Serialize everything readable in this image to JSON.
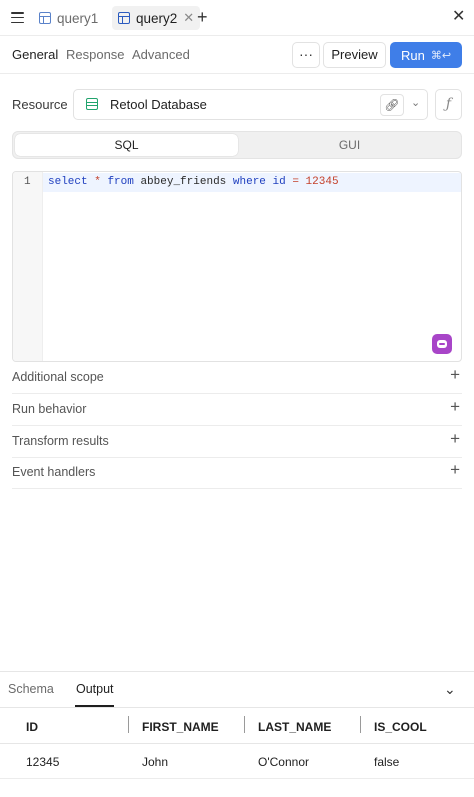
{
  "tabs": {
    "items": [
      {
        "label": "query1",
        "active": false
      },
      {
        "label": "query2",
        "active": true
      }
    ],
    "add_icon": "plus-icon",
    "close_icon": "close-icon"
  },
  "subnav": {
    "tabs": [
      "General",
      "Response",
      "Advanced"
    ],
    "active": "General",
    "more_label": "···",
    "preview_label": "Preview",
    "run_label": "Run",
    "run_shortcut": "⌘↩"
  },
  "resource": {
    "label": "Resource",
    "name": "Retool Database",
    "fx_label": "ƒ"
  },
  "mode": {
    "options": [
      "SQL",
      "GUI"
    ],
    "selected": "SQL"
  },
  "editor": {
    "line_number": "1",
    "tokens": {
      "t1": "select",
      "t2": "*",
      "t3": "from",
      "t4": "abbey_friends",
      "t5": "where",
      "t6": "id",
      "t7": "=",
      "t8": "12345"
    }
  },
  "sections": [
    "Additional scope",
    "Run behavior",
    "Transform results",
    "Event handlers"
  ],
  "bottom_panel": {
    "tabs": [
      "Schema",
      "Output"
    ],
    "active": "Output",
    "table": {
      "columns": [
        "ID",
        "FIRST_NAME",
        "LAST_NAME",
        "IS_COOL"
      ],
      "rows": [
        [
          "12345",
          "John",
          "O'Connor",
          "false"
        ]
      ]
    }
  },
  "colors": {
    "accent": "#3f7ee8",
    "database": "#21a46d",
    "ai": "#a845c8"
  }
}
